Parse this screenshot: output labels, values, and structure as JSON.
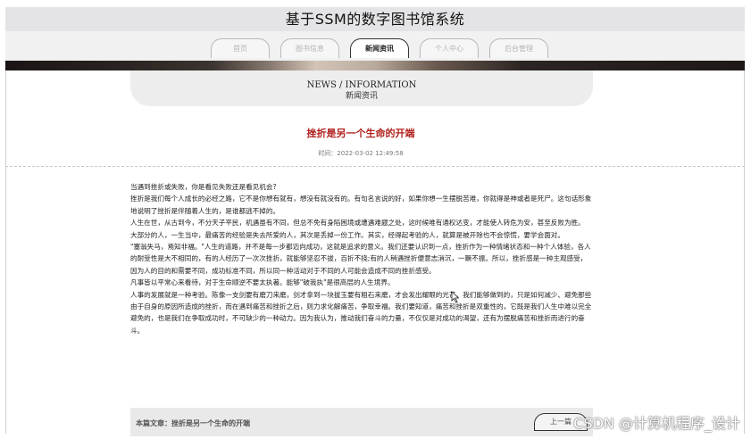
{
  "header": {
    "site_title": "基于SSM的数字图书馆系统"
  },
  "nav": {
    "items": [
      {
        "label": "首页"
      },
      {
        "label": "图书信息"
      },
      {
        "label": "新闻资讯"
      },
      {
        "label": "个人中心"
      },
      {
        "label": "后台管理"
      }
    ],
    "active": "新闻资讯"
  },
  "section": {
    "en": "NEWS / INFORMATION",
    "cn": "新闻资讯"
  },
  "article": {
    "title": "挫折是另一个生命的开端",
    "time": "时间：2022-03-02 12:49:58",
    "paragraphs": [
      "当遇到挫折或失败，你是看见失败还是看见机会?",
      "挫折是我们每个人成长的必经之路，它不是你想有就有，想没有就没有的。有句名言说的好，如果你想一生摆脱苦难，你就得是神或者是死尸。这句话形象地说明了挫折是伴随着人生的，是谁都逃不掉的。",
      "人生在世，从古到今，不分天子平民，机遇虽有不同，但总不免有身陷困境或遭遇难题之处，这时候唯有通权达变，才能使人转危为安，甚至反败为胜。",
      "大部分的人，一生当中，最痛苦的经验是失去所爱的人，其次是丢掉一份工作。其实，经得起考验的人，就算是被开除也不会惊慌，要学会面对。",
      "\"塞翁失马，焉知非福。\"人生的道路，并不是每一步都迈向成功，这就是追求的意义。我们还要认识到一点，挫折作为一种情绪状态和一种个人体验，各人的耐受性是大不相同的，有的人经历了一次次挫折，就能够坚忍不拔，百折不挠;有的人稍遇挫折便意志消沉，一蹶不振。所以，挫折感是一种主观感受，因为人的目的和需要不同，成功标准不同，所以同一种活动对于不同的人可能会造成不同的挫折感受。",
      "凡事皆以平常心来看待，对于生命顺逆不要太执著。能够\"破我执\"是很高层的人生境界。",
      "人事的发展就是一种考验。陈像一支剑要有磨刀来磨，剑才拿到一块拔玉要有粗石来磨，才会发出耀眼的光芒。我们能够做到的，只是如何减少、避免那些由于自身的原因所造成的挫折，而在遇到痛苦和挫折之后，则力求化解痛苦，争取幸福。我们要知道，痛苦和挫折是双重性的，它既是我们人生中难以完全避免的，也是我们在争取成功时，不可缺少的一种动力。因为我认为，推动我们奋斗的力量，不仅仅是对成功的渴望，还有为摆脱痛苦和挫折而进行的奋斗。"
    ]
  },
  "footer": {
    "current_label": "本篇文章：挫折是另一个生命的开端",
    "button_label": "上一篇"
  },
  "watermark": "CSDN @计算机程序_设计"
}
